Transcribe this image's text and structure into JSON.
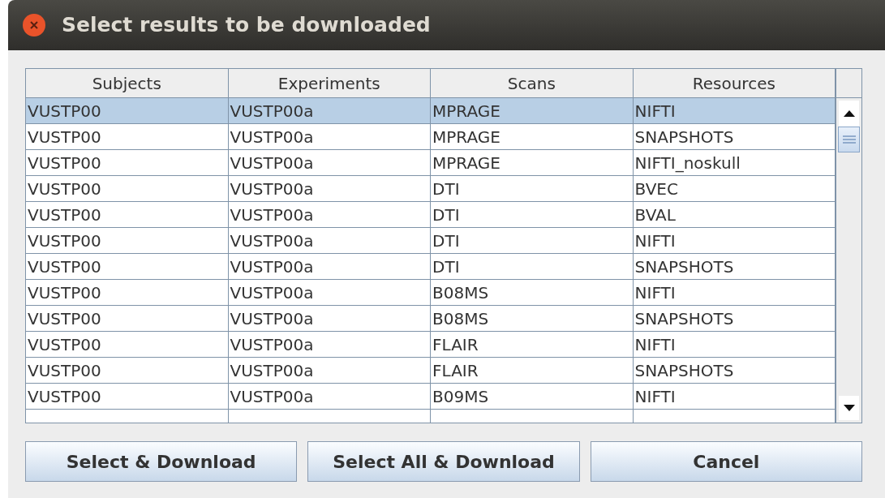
{
  "window": {
    "title": "Select results to be downloaded"
  },
  "table": {
    "columns": [
      "Subjects",
      "Experiments",
      "Scans",
      "Resources"
    ],
    "rows": [
      {
        "cells": [
          "VUSTP00",
          "VUSTP00a",
          "MPRAGE",
          "NIFTI"
        ],
        "selected": true
      },
      {
        "cells": [
          "VUSTP00",
          "VUSTP00a",
          "MPRAGE",
          "SNAPSHOTS"
        ],
        "selected": false
      },
      {
        "cells": [
          "VUSTP00",
          "VUSTP00a",
          "MPRAGE",
          "NIFTI_noskull"
        ],
        "selected": false
      },
      {
        "cells": [
          "VUSTP00",
          "VUSTP00a",
          "DTI",
          "BVEC"
        ],
        "selected": false
      },
      {
        "cells": [
          "VUSTP00",
          "VUSTP00a",
          "DTI",
          "BVAL"
        ],
        "selected": false
      },
      {
        "cells": [
          "VUSTP00",
          "VUSTP00a",
          "DTI",
          "NIFTI"
        ],
        "selected": false
      },
      {
        "cells": [
          "VUSTP00",
          "VUSTP00a",
          "DTI",
          "SNAPSHOTS"
        ],
        "selected": false
      },
      {
        "cells": [
          "VUSTP00",
          "VUSTP00a",
          "B08MS",
          "NIFTI"
        ],
        "selected": false
      },
      {
        "cells": [
          "VUSTP00",
          "VUSTP00a",
          "B08MS",
          "SNAPSHOTS"
        ],
        "selected": false
      },
      {
        "cells": [
          "VUSTP00",
          "VUSTP00a",
          "FLAIR",
          "NIFTI"
        ],
        "selected": false
      },
      {
        "cells": [
          "VUSTP00",
          "VUSTP00a",
          "FLAIR",
          "SNAPSHOTS"
        ],
        "selected": false
      },
      {
        "cells": [
          "VUSTP00",
          "VUSTP00a",
          "B09MS",
          "NIFTI"
        ],
        "selected": false
      }
    ]
  },
  "buttons": [
    "Select & Download",
    "Select All & Download",
    "Cancel"
  ]
}
